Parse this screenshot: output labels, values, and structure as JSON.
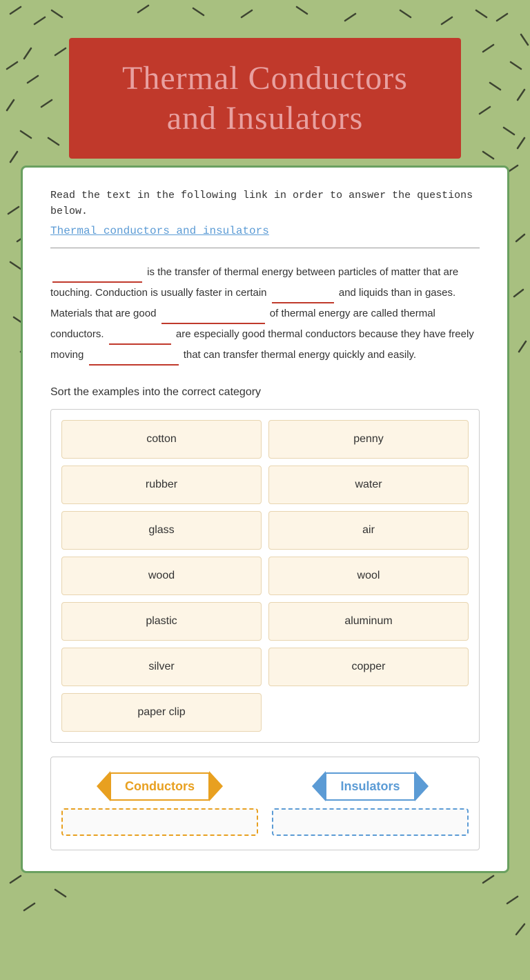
{
  "header": {
    "title": "Thermal Conductors and Insulators"
  },
  "instruction": {
    "main_text": "Read the text in the following link in order to answer the questions below",
    "period": ".",
    "link_text": "Thermal conductors and insulators"
  },
  "paragraph": {
    "text_parts": [
      {
        "type": "blank",
        "size": "medium"
      },
      {
        "type": "text",
        "content": " is the transfer of thermal energy between particles of matter that are touching. Conduction is usually faster in certain "
      },
      {
        "type": "blank",
        "size": "short"
      },
      {
        "type": "text",
        "content": " and liquids than in gases. Materials that are good "
      },
      {
        "type": "blank",
        "size": "long"
      },
      {
        "type": "text",
        "content": " of thermal energy are called thermal conductors. "
      },
      {
        "type": "blank",
        "size": "short"
      },
      {
        "type": "text",
        "content": " are especially good thermal conductors because they have freely moving "
      },
      {
        "type": "blank",
        "size": "medium"
      },
      {
        "type": "text",
        "content": " that can transfer thermal energy quickly and easily."
      }
    ]
  },
  "sort_section": {
    "instruction": "Sort the examples into the correct category",
    "items": [
      {
        "id": 1,
        "label": "cotton"
      },
      {
        "id": 2,
        "label": "penny"
      },
      {
        "id": 3,
        "label": "rubber"
      },
      {
        "id": 4,
        "label": "water"
      },
      {
        "id": 5,
        "label": "glass"
      },
      {
        "id": 6,
        "label": "air"
      },
      {
        "id": 7,
        "label": "wood"
      },
      {
        "id": 8,
        "label": "wool"
      },
      {
        "id": 9,
        "label": "plastic"
      },
      {
        "id": 10,
        "label": "aluminum"
      },
      {
        "id": 11,
        "label": "silver"
      },
      {
        "id": 12,
        "label": "copper"
      },
      {
        "id": 13,
        "label": "paper clip"
      }
    ]
  },
  "categories": {
    "conductors": {
      "label": "Conductors",
      "color": "#e8a020"
    },
    "insulators": {
      "label": "Insulators",
      "color": "#5b9bd5"
    }
  },
  "colors": {
    "header_bg": "#c0392b",
    "header_text": "#e8a0a0",
    "body_bg": "#a8c080",
    "card_bg": "#ffffff",
    "card_border": "#6aa060",
    "instruction_red": "#c0392b",
    "link_blue": "#5b9bd5",
    "blank_underline": "#c0392b",
    "sort_item_bg": "#fdf5e6",
    "conductors_color": "#e8a020",
    "insulators_color": "#5b9bd5"
  }
}
